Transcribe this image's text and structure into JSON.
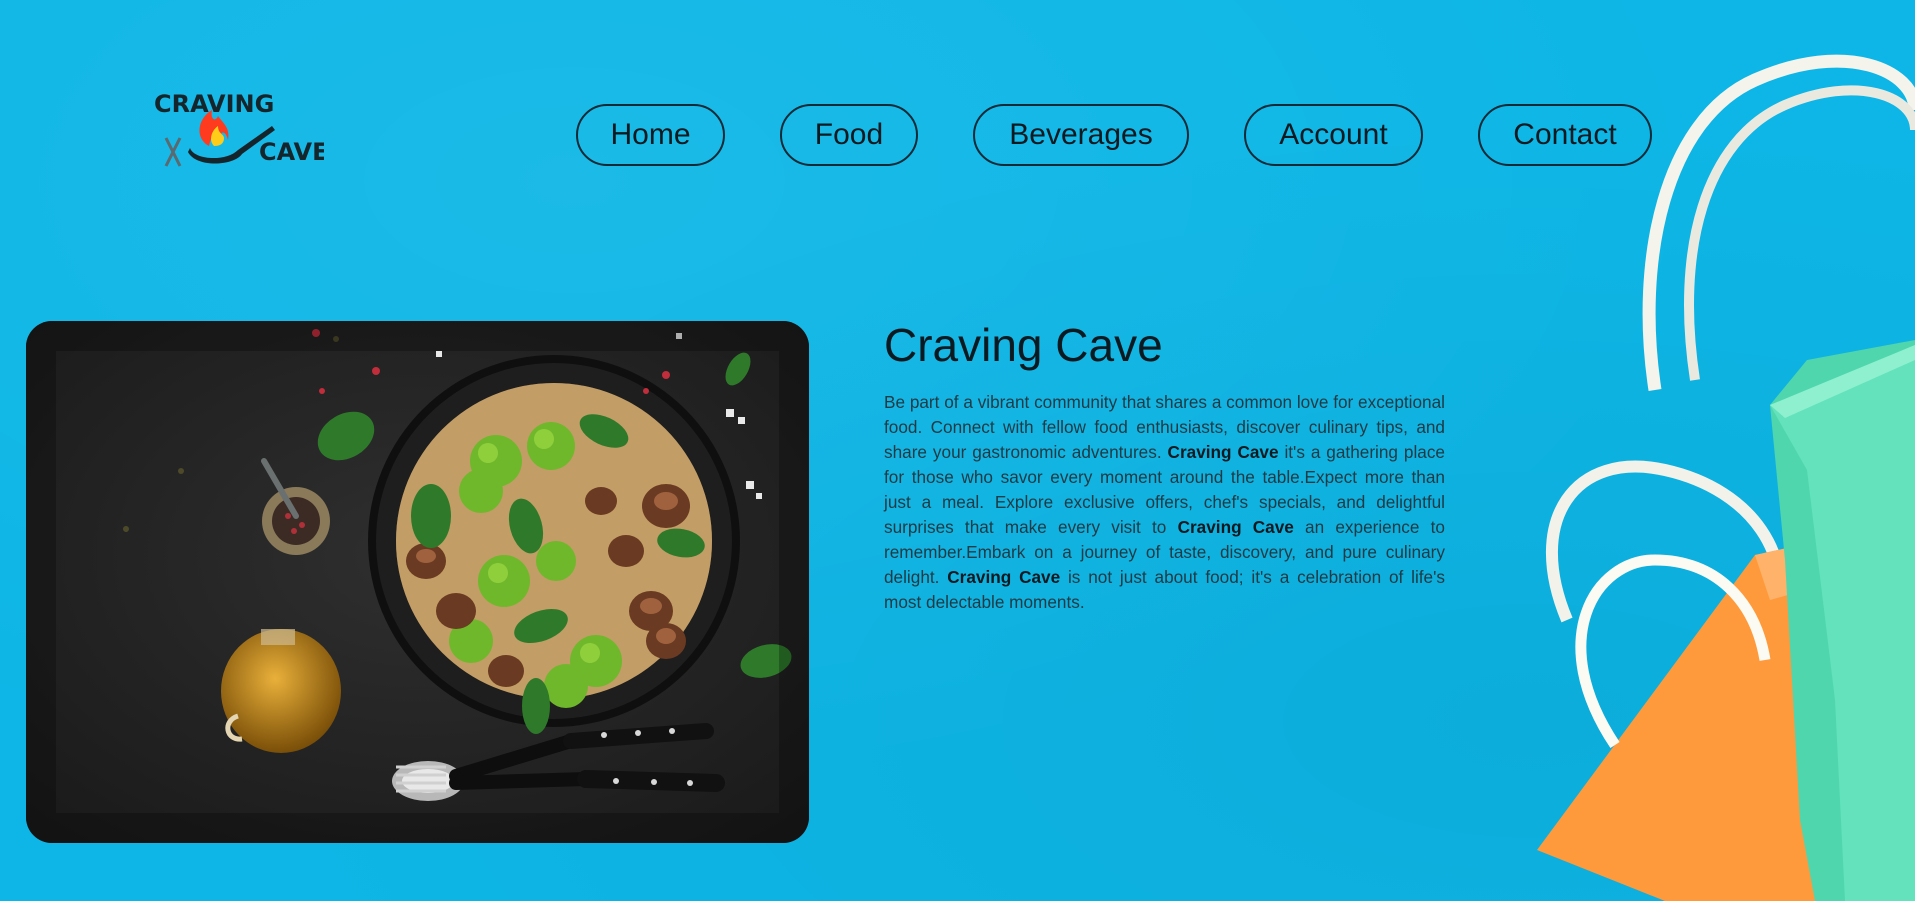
{
  "logo": {
    "line1": "CRAVING",
    "line2": "CAVE",
    "alt": "Craving Cave logo"
  },
  "nav": {
    "items": [
      {
        "label": "Home"
      },
      {
        "label": "Food"
      },
      {
        "label": "Beverages"
      },
      {
        "label": "Account"
      },
      {
        "label": "Contact"
      }
    ]
  },
  "intro": {
    "title": "Craving Cave",
    "segments": [
      {
        "text": "Be part of a vibrant community that shares a common love for exceptional food. Connect with fellow food enthusiasts, discover culinary tips, and share your gastronomic adventures. ",
        "bold": false
      },
      {
        "text": "Craving Cave",
        "bold": true
      },
      {
        "text": " it's a gathering place for those who savor every moment around the table.Expect more than just a meal. Explore exclusive offers, chef's specials, and delightful surprises that make every visit to ",
        "bold": false
      },
      {
        "text": "Craving Cave",
        "bold": true
      },
      {
        "text": " an experience to remember.Embark on a journey of taste, discovery, and pure culinary delight. ",
        "bold": false
      },
      {
        "text": "Craving Cave",
        "bold": true
      },
      {
        "text": " is not just about food; it's a celebration of life's most delectable moments.",
        "bold": false
      }
    ]
  },
  "colors": {
    "background": "#0db6e6",
    "nav_border": "#0d2a36",
    "bag_green": "#5fe0b8",
    "bag_orange": "#ff9f45"
  }
}
